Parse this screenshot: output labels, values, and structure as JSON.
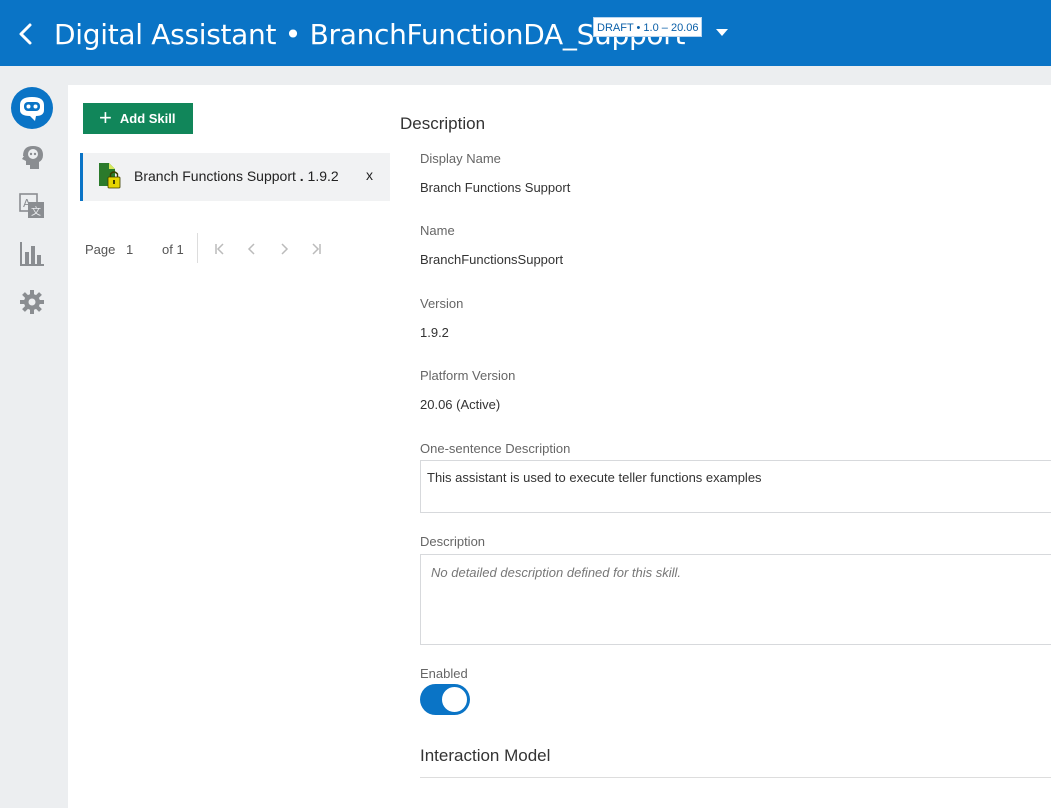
{
  "header": {
    "title": "Digital Assistant • BranchFunctionDA_Support",
    "version_badge": "DRAFT • 1.0 – 20.06",
    "back_icon": "chevron-left-icon",
    "menu_icon": "caret-down-icon"
  },
  "sidenav": {
    "items": [
      {
        "icon": "bot-icon",
        "active": true
      },
      {
        "icon": "head-bubble-icon",
        "active": false
      },
      {
        "icon": "translate-icon",
        "active": false
      },
      {
        "icon": "bar-chart-icon",
        "active": false
      },
      {
        "icon": "gear-icon",
        "active": false
      }
    ]
  },
  "skills": {
    "add_label": "Add Skill",
    "items": [
      {
        "name": "Branch Functions Support",
        "version": "1.9.2",
        "remove_label": "x"
      }
    ]
  },
  "pager": {
    "page_label": "Page",
    "page_number": "1",
    "of_label": "of 1"
  },
  "details": {
    "section_title": "Description",
    "display_name_label": "Display Name",
    "display_name_value": "Branch Functions Support",
    "name_label": "Name",
    "name_value": "BranchFunctionsSupport",
    "version_label": "Version",
    "version_value": "1.9.2",
    "platform_version_label": "Platform Version",
    "platform_version_value": "20.06 (Active)",
    "one_sentence_label": "One-sentence Description",
    "one_sentence_value": "This assistant is used to execute teller functions examples",
    "description_label": "Description",
    "description_placeholder": "No detailed description defined for this skill.",
    "enabled_label": "Enabled",
    "enabled": true,
    "interaction_model_title": "Interaction Model"
  },
  "colors": {
    "header_blue": "#0a74c6",
    "add_button_green": "#11865a"
  }
}
